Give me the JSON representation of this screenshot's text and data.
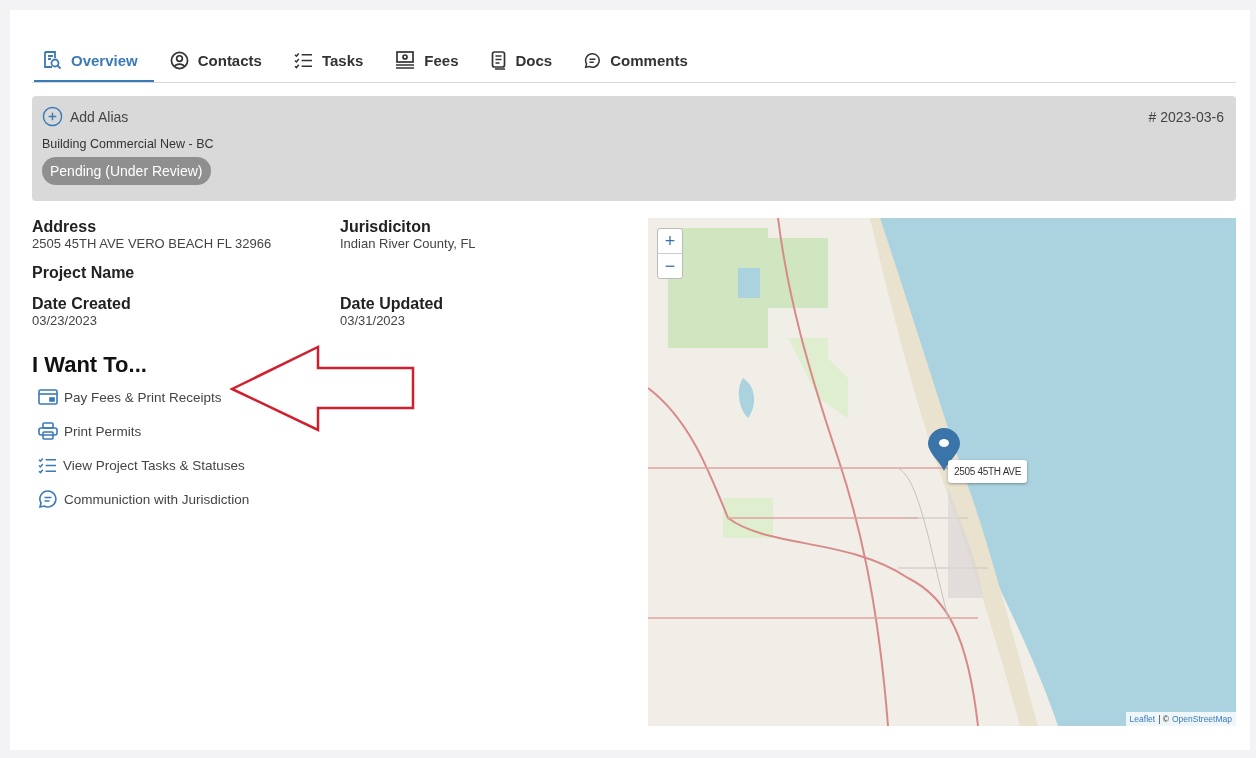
{
  "tabs": [
    {
      "label": "Overview",
      "kind": "overview",
      "selected": true
    },
    {
      "label": "Contacts",
      "kind": "contacts",
      "selected": false
    },
    {
      "label": "Tasks",
      "kind": "tasks",
      "selected": false
    },
    {
      "label": "Fees",
      "kind": "fees",
      "selected": false
    },
    {
      "label": "Docs",
      "kind": "docs",
      "selected": false
    },
    {
      "label": "Comments",
      "kind": "comments",
      "selected": false
    }
  ],
  "header": {
    "add_alias": "Add Alias",
    "permit_number": "# 2023-03-6",
    "permit_type": "Building Commercial New - BC",
    "status": "Pending (Under Review)"
  },
  "details": [
    {
      "label": "Address",
      "value": "2505 45TH AVE VERO BEACH FL 32966"
    },
    {
      "label": "Jurisdiciton",
      "value": "Indian River County, FL"
    },
    {
      "label": "Project Name"
    },
    {
      "label": "Date Created",
      "value": "03/23/2023"
    },
    {
      "label": "Date Updated",
      "value": "03/31/2023"
    }
  ],
  "actions": {
    "title": "I Want To...",
    "items": [
      {
        "kind": "card",
        "label": "Pay Fees & Print Receipts"
      },
      {
        "kind": "printer",
        "label": "Print Permits"
      },
      {
        "kind": "checklist",
        "label": "View Project Tasks & Statuses"
      },
      {
        "kind": "chat",
        "label": "Communiction with Jurisdiction"
      }
    ]
  },
  "map": {
    "zoom_in": "+",
    "zoom_out": "−",
    "marker_label": "2505 45TH AVE",
    "attribution_links": [
      "Leaflet",
      "OpenStreetMap"
    ],
    "attribution_separator": "| ©"
  }
}
